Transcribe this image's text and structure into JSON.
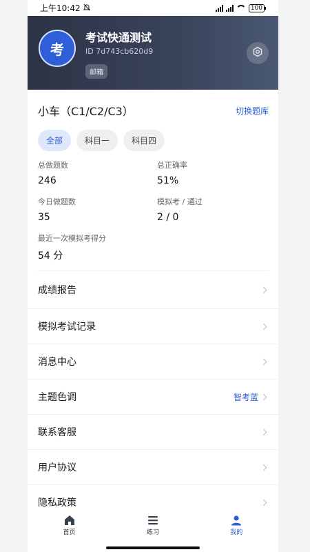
{
  "status_bar": {
    "time": "上午10:42",
    "battery": "100"
  },
  "profile": {
    "avatar_char": "考",
    "name": "考试快通测试",
    "id": "ID 7d743cb620d9",
    "tag": "邮箱"
  },
  "vehicle": {
    "title": "小车（C1/C2/C3）",
    "switch_label": "切换题库"
  },
  "tabs": [
    {
      "label": "全部",
      "active": true
    },
    {
      "label": "科目一",
      "active": false
    },
    {
      "label": "科目四",
      "active": false
    }
  ],
  "stats": {
    "total_label": "总做题数",
    "total_value": "246",
    "accuracy_label": "总正确率",
    "accuracy_value": "51%",
    "today_label": "今日做题数",
    "today_value": "35",
    "mock_label": "模拟考 / 通过",
    "mock_value": "2 / 0",
    "last_score_label": "最近一次模拟考得分",
    "last_score_value": "54 分"
  },
  "menu": [
    {
      "label": "成绩报告",
      "value": ""
    },
    {
      "label": "模拟考试记录",
      "value": ""
    },
    {
      "label": "消息中心",
      "value": ""
    },
    {
      "label": "主题色调",
      "value": "智考蓝"
    },
    {
      "label": "联系客服",
      "value": ""
    },
    {
      "label": "用户协议",
      "value": ""
    },
    {
      "label": "隐私政策",
      "value": ""
    }
  ],
  "nav": {
    "home": "首页",
    "practice": "练习",
    "mine": "我的"
  },
  "colors": {
    "accent": "#2f5ed9",
    "header_dark": "#2c3346"
  }
}
